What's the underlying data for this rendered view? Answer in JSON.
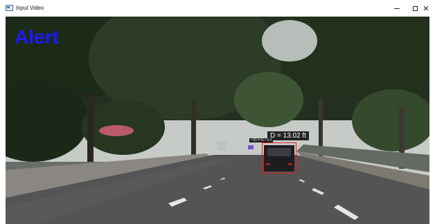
{
  "window": {
    "title": "Input Video",
    "minimize_glyph": "–",
    "maximize_glyph": "☐",
    "close_glyph": "✕"
  },
  "video": {
    "alert_text": "Alert",
    "detection": {
      "distance_label": "D = 13.02 ft",
      "class_label": "• 83.4 % • 0.3"
    }
  },
  "colors": {
    "alert": "#1a1aff",
    "bbox": "#e0201c",
    "label_bg": "#222222"
  },
  "icons": {
    "app": "video-window-icon",
    "minimize": "minimize-icon",
    "maximize": "maximize-icon",
    "close": "close-icon"
  }
}
